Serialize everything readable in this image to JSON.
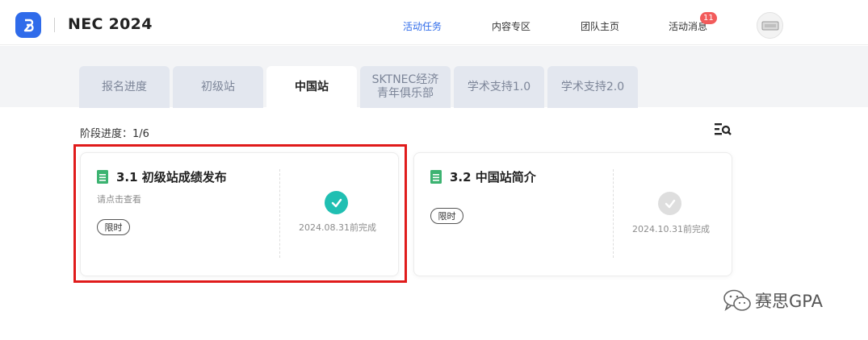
{
  "header": {
    "brand": "NEC 2024",
    "nav": [
      {
        "label": "活动任务",
        "active": true
      },
      {
        "label": "内容专区",
        "active": false
      },
      {
        "label": "团队主页",
        "active": false
      },
      {
        "label": "活动消息",
        "active": false
      }
    ],
    "message_badge": "11"
  },
  "tabs": [
    {
      "label": "报名进度"
    },
    {
      "label": "初级站"
    },
    {
      "label": "中国站"
    },
    {
      "label_line1": "SKTNEC经济",
      "label_line2": "青年俱乐部"
    },
    {
      "label": "学术支持1.0"
    },
    {
      "label": "学术支持2.0"
    }
  ],
  "active_tab": "中国站",
  "progress": {
    "label": "阶段进度：",
    "value": "1/6"
  },
  "tasks": [
    {
      "title": "3.1 初级站成绩发布",
      "subtitle": "请点击查看",
      "tag": "限时",
      "deadline": "2024.08.31前完成",
      "status": "completed",
      "highlighted": true
    },
    {
      "title": "3.2 中国站简介",
      "tag": "限时",
      "deadline": "2024.10.31前完成",
      "status": "pending",
      "highlighted": false
    }
  ],
  "watermark": {
    "text": "赛思GPA",
    "icon": "wechat-icon"
  },
  "colors": {
    "accent": "#2f6bea",
    "completed": "#20bfb2",
    "pending": "#dedede",
    "doc_icon": "#3cb371",
    "badge": "#f25b5b",
    "highlight": "#e01b1b"
  }
}
